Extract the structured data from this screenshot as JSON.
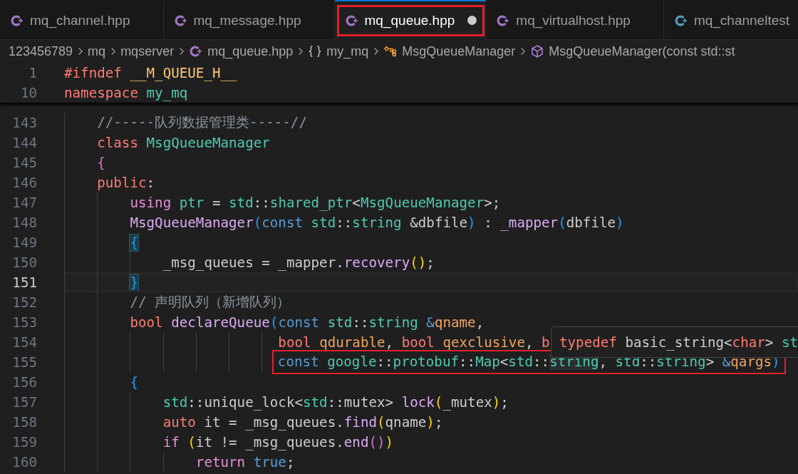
{
  "tabs": [
    {
      "label": "mq_channel.hpp",
      "color": "#a074c4",
      "selected": false,
      "modified": false,
      "annotated": false
    },
    {
      "label": "mq_message.hpp",
      "color": "#a074c4",
      "selected": false,
      "modified": false,
      "annotated": false
    },
    {
      "label": "mq_queue.hpp",
      "color": "#a074c4",
      "selected": true,
      "modified": true,
      "annotated": true
    },
    {
      "label": "mq_virtualhost.hpp",
      "color": "#a074c4",
      "selected": false,
      "modified": false,
      "annotated": false
    },
    {
      "label": "mq_channeltest",
      "color": "#519aba",
      "selected": false,
      "modified": false,
      "annotated": false
    }
  ],
  "breadcrumb": [
    {
      "kind": "folder",
      "label": "123456789"
    },
    {
      "kind": "folder",
      "label": "mq"
    },
    {
      "kind": "folder",
      "label": "mqserver"
    },
    {
      "kind": "file",
      "label": "mq_queue.hpp"
    },
    {
      "kind": "namespace",
      "label": "my_mq"
    },
    {
      "kind": "class",
      "label": "MsgQueueManager"
    },
    {
      "kind": "method",
      "label": "MsgQueueManager(const std::st"
    }
  ],
  "sticky_lines": [
    {
      "number": "1",
      "tokens": [
        {
          "kind": "kw",
          "text": "#ifndef"
        },
        {
          "kind": "macro",
          "text": " __M_QUEUE_H__"
        }
      ]
    },
    {
      "number": "10",
      "tokens": [
        {
          "kind": "kw",
          "text": "namespace"
        },
        {
          "kind": "type",
          "text": " my_mq"
        }
      ]
    }
  ],
  "lines": [
    {
      "number": "143",
      "current": false,
      "annotated": false,
      "tokens": [
        {
          "kind": "comment",
          "text": "    //-----队列数据管理类-----//"
        }
      ]
    },
    {
      "number": "144",
      "current": false,
      "annotated": false,
      "tokens": [
        {
          "kind": "kw",
          "text": "    class"
        },
        {
          "kind": "type",
          "text": " MsgQueueManager"
        }
      ]
    },
    {
      "number": "145",
      "current": false,
      "annotated": false,
      "tokens": [
        {
          "kind": "br2",
          "text": "    {"
        }
      ]
    },
    {
      "number": "146",
      "current": false,
      "annotated": false,
      "tokens": [
        {
          "kind": "kw",
          "text": "    public"
        },
        {
          "kind": "plain",
          "text": ":"
        }
      ]
    },
    {
      "number": "147",
      "current": false,
      "annotated": false,
      "tokens": [
        {
          "kind": "ctrl",
          "text": "        using"
        },
        {
          "kind": "type",
          "text": " ptr"
        },
        {
          "kind": "plain",
          "text": " = "
        },
        {
          "kind": "type",
          "text": "std"
        },
        {
          "kind": "plain",
          "text": "::"
        },
        {
          "kind": "type",
          "text": "shared_ptr"
        },
        {
          "kind": "plain",
          "text": "<"
        },
        {
          "kind": "type",
          "text": "MsgQueueManager"
        },
        {
          "kind": "plain",
          "text": ">;"
        }
      ]
    },
    {
      "number": "148",
      "current": false,
      "annotated": false,
      "tokens": [
        {
          "kind": "fn",
          "text": "        MsgQueueManager"
        },
        {
          "kind": "br3",
          "text": "("
        },
        {
          "kind": "storage",
          "text": "const"
        },
        {
          "kind": "type",
          "text": " std"
        },
        {
          "kind": "plain",
          "text": "::"
        },
        {
          "kind": "type",
          "text": "string"
        },
        {
          "kind": "plain",
          "text": " &dbfile"
        },
        {
          "kind": "br3",
          "text": ")"
        },
        {
          "kind": "plain",
          "text": " : "
        },
        {
          "kind": "fn",
          "text": "_mapper"
        },
        {
          "kind": "br3",
          "text": "("
        },
        {
          "kind": "plain",
          "text": "dbfile"
        },
        {
          "kind": "br3",
          "text": ")"
        }
      ]
    },
    {
      "number": "149",
      "current": false,
      "annotated": false,
      "tokens": [
        {
          "kind": "match",
          "text": "        {"
        }
      ]
    },
    {
      "number": "150",
      "current": false,
      "annotated": false,
      "tokens": [
        {
          "kind": "plain",
          "text": "            _msg_queues = _mapper."
        },
        {
          "kind": "fn",
          "text": "recovery"
        },
        {
          "kind": "br1",
          "text": "()"
        },
        {
          "kind": "plain",
          "text": ";"
        }
      ]
    },
    {
      "number": "151",
      "current": true,
      "annotated": false,
      "tokens": [
        {
          "kind": "match",
          "text": "        }"
        }
      ]
    },
    {
      "number": "152",
      "current": false,
      "annotated": false,
      "tokens": [
        {
          "kind": "comment",
          "text": "        // 声明队列（新增队列）"
        }
      ]
    },
    {
      "number": "153",
      "current": false,
      "annotated": false,
      "tokens": [
        {
          "kind": "kw",
          "text": "        bool"
        },
        {
          "kind": "fn",
          "text": " declareQueue"
        },
        {
          "kind": "br3",
          "text": "("
        },
        {
          "kind": "storage",
          "text": "const"
        },
        {
          "kind": "type",
          "text": " std"
        },
        {
          "kind": "plain",
          "text": "::"
        },
        {
          "kind": "type",
          "text": "string"
        },
        {
          "kind": "storage",
          "text": " &"
        },
        {
          "kind": "param",
          "text": "qname"
        },
        {
          "kind": "plain",
          "text": ","
        }
      ]
    },
    {
      "number": "154",
      "current": false,
      "annotated": false,
      "tokens": [
        {
          "kind": "kw",
          "text": "                          bool"
        },
        {
          "kind": "param",
          "text": " qdurable"
        },
        {
          "kind": "plain",
          "text": ", "
        },
        {
          "kind": "kw",
          "text": "bool"
        },
        {
          "kind": "param",
          "text": " qexclusive"
        },
        {
          "kind": "plain",
          "text": ", "
        },
        {
          "kind": "kw",
          "text": "b"
        }
      ]
    },
    {
      "number": "155",
      "current": false,
      "annotated": true,
      "tokens": [
        {
          "kind": "storage",
          "text": "                          const"
        },
        {
          "kind": "type",
          "text": " google"
        },
        {
          "kind": "plain",
          "text": "::"
        },
        {
          "kind": "type",
          "text": "protobuf"
        },
        {
          "kind": "plain",
          "text": "::"
        },
        {
          "kind": "type",
          "text": "Map"
        },
        {
          "kind": "plain",
          "text": "<"
        },
        {
          "kind": "type",
          "text": "std"
        },
        {
          "kind": "plain",
          "text": "::"
        },
        {
          "kind": "hover",
          "text": "string"
        },
        {
          "kind": "plain",
          "text": ", "
        },
        {
          "kind": "type",
          "text": "std"
        },
        {
          "kind": "plain",
          "text": "::"
        },
        {
          "kind": "type",
          "text": "string"
        },
        {
          "kind": "plain",
          "text": "> "
        },
        {
          "kind": "storage",
          "text": "&"
        },
        {
          "kind": "param",
          "text": "qargs"
        },
        {
          "kind": "br3",
          "text": ")"
        }
      ]
    },
    {
      "number": "156",
      "current": false,
      "annotated": false,
      "tokens": [
        {
          "kind": "br3",
          "text": "        {"
        }
      ]
    },
    {
      "number": "157",
      "current": false,
      "annotated": false,
      "tokens": [
        {
          "kind": "type",
          "text": "            std"
        },
        {
          "kind": "plain",
          "text": "::unique_lock<"
        },
        {
          "kind": "type",
          "text": "std"
        },
        {
          "kind": "plain",
          "text": "::mutex> "
        },
        {
          "kind": "fn",
          "text": "lock"
        },
        {
          "kind": "br1",
          "text": "("
        },
        {
          "kind": "plain",
          "text": "_mutex"
        },
        {
          "kind": "br1",
          "text": ")"
        },
        {
          "kind": "plain",
          "text": ";"
        }
      ]
    },
    {
      "number": "158",
      "current": false,
      "annotated": false,
      "tokens": [
        {
          "kind": "kw",
          "text": "            auto"
        },
        {
          "kind": "plain",
          "text": " it = _msg_queues."
        },
        {
          "kind": "fn",
          "text": "find"
        },
        {
          "kind": "br1",
          "text": "("
        },
        {
          "kind": "plain",
          "text": "qname"
        },
        {
          "kind": "br1",
          "text": ")"
        },
        {
          "kind": "plain",
          "text": ";"
        }
      ]
    },
    {
      "number": "159",
      "current": false,
      "annotated": false,
      "tokens": [
        {
          "kind": "ctrl",
          "text": "            if"
        },
        {
          "kind": "br1",
          "text": " ("
        },
        {
          "kind": "plain",
          "text": "it != _msg_queues."
        },
        {
          "kind": "fn",
          "text": "end"
        },
        {
          "kind": "br2",
          "text": "()"
        },
        {
          "kind": "br1",
          "text": ")"
        }
      ]
    },
    {
      "number": "160",
      "current": false,
      "annotated": false,
      "tokens": [
        {
          "kind": "ctrl",
          "text": "                return"
        },
        {
          "kind": "storage",
          "text": " true"
        },
        {
          "kind": "plain",
          "text": ";"
        }
      ]
    }
  ],
  "hover_popup": {
    "tokens": [
      {
        "kind": "kw",
        "text": "typedef"
      },
      {
        "kind": "plain",
        "text": " basic_string<"
      },
      {
        "kind": "kw",
        "text": "char"
      },
      {
        "kind": "plain",
        "text": "> "
      },
      {
        "kind": "type",
        "text": "st"
      }
    ]
  }
}
